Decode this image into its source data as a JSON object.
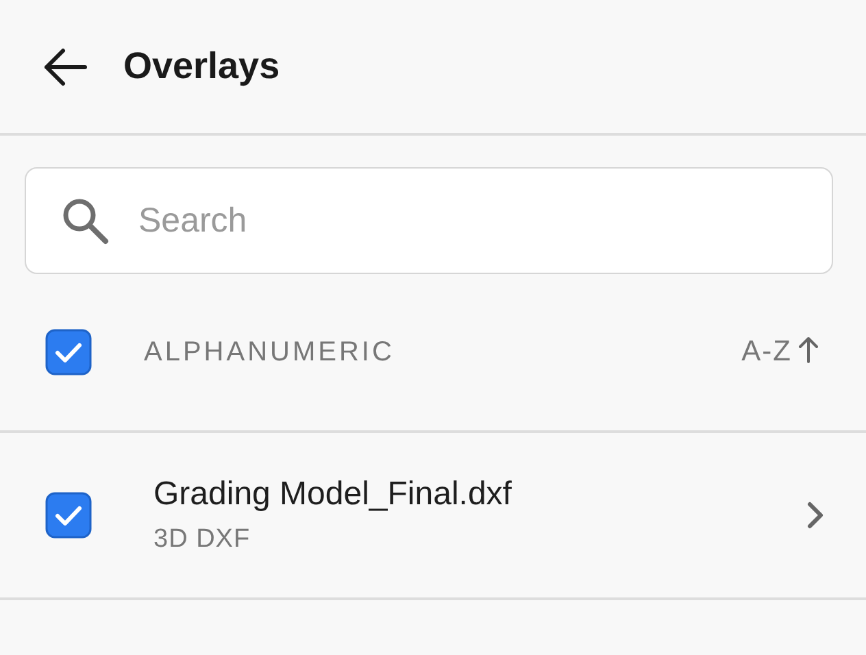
{
  "header": {
    "title": "Overlays"
  },
  "search": {
    "placeholder": "Search"
  },
  "sort_bar": {
    "checked": true,
    "label": "ALPHANUMERIC",
    "sort": "A-Z"
  },
  "items": [
    {
      "name": "Grading Model_Final.dxf",
      "type": "3D DXF",
      "checked": true
    }
  ]
}
